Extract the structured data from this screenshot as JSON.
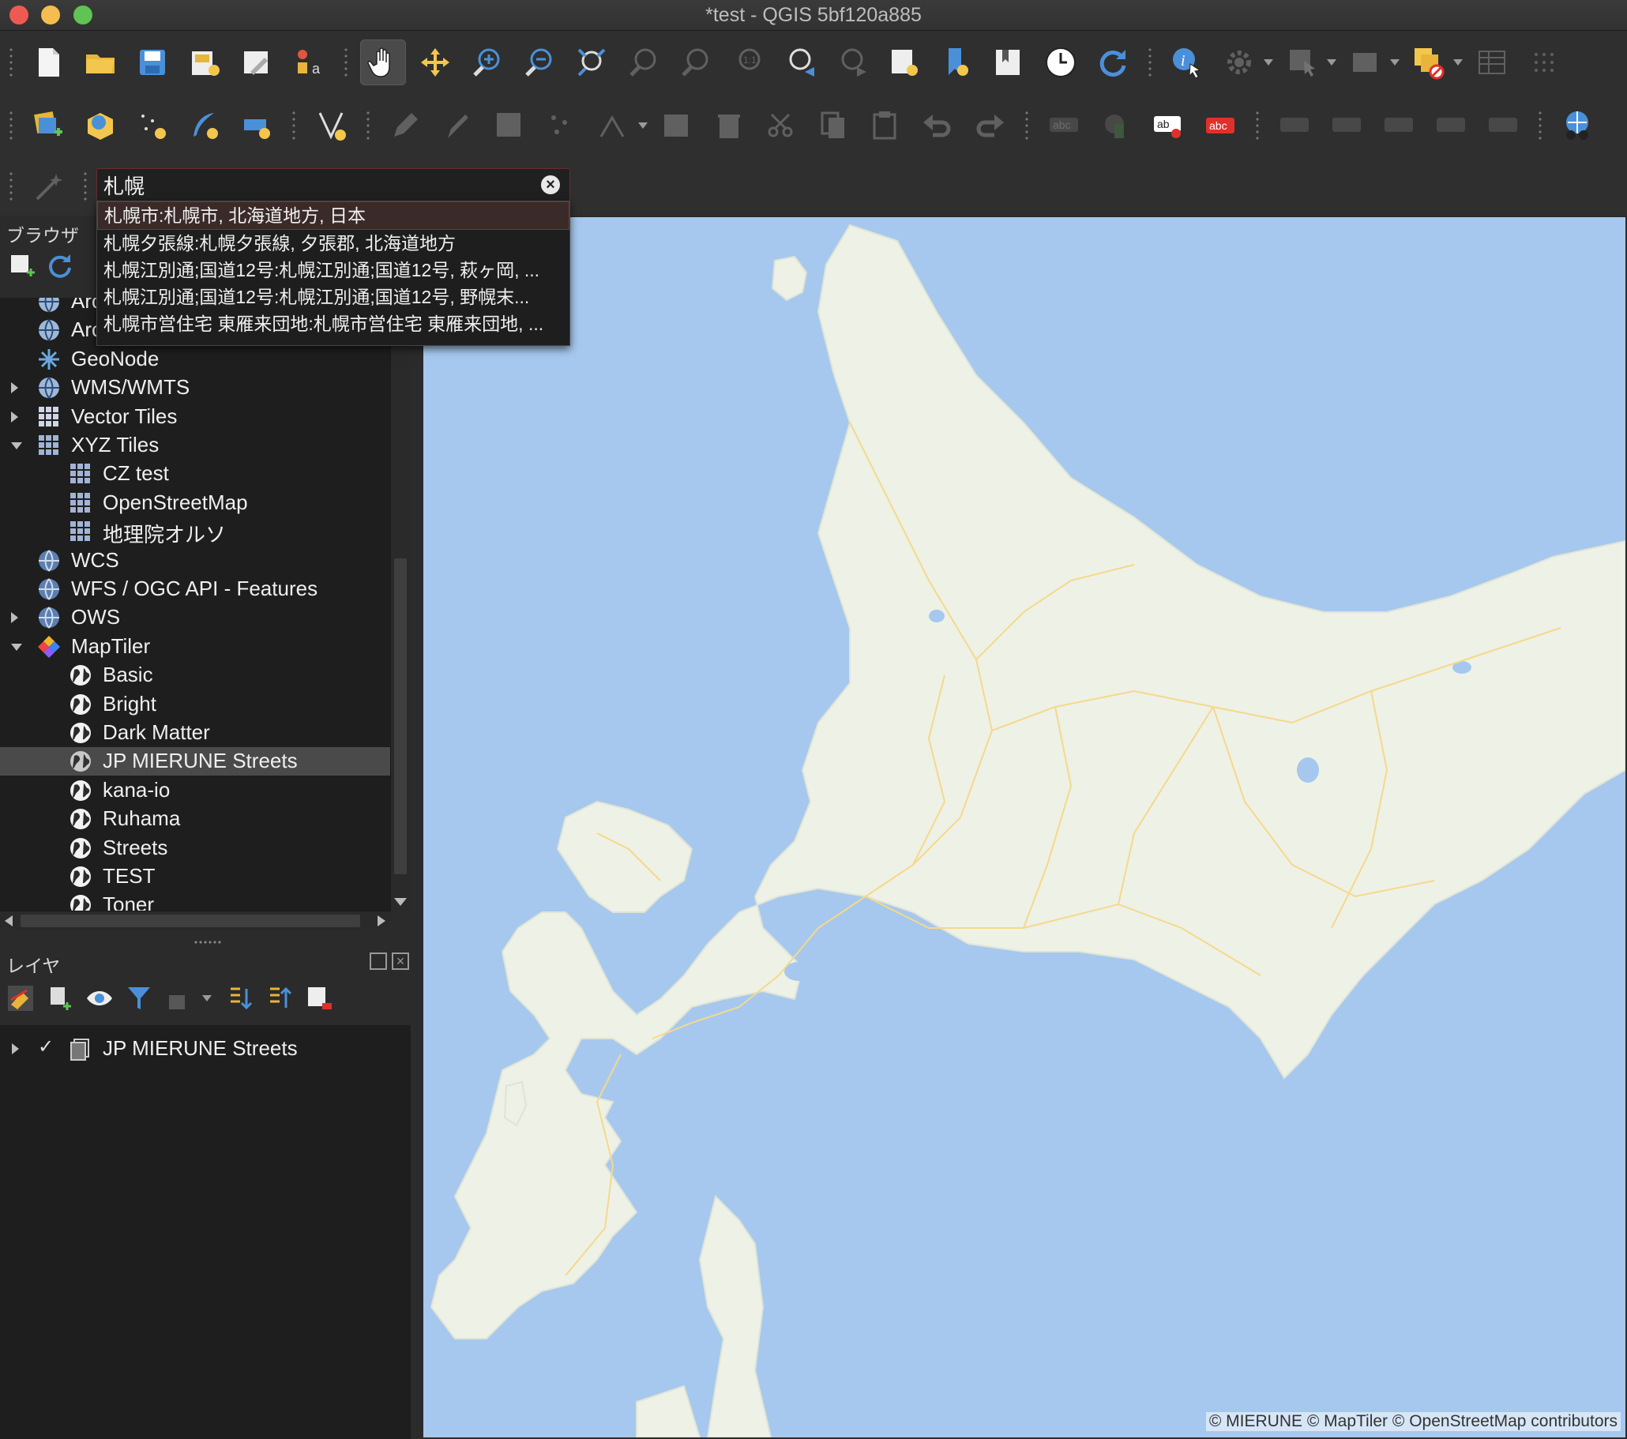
{
  "window": {
    "title": "*test - QGIS 5bf120a885"
  },
  "colors": {
    "accent": "#4a90d9",
    "sea": "#a6c8ee",
    "land": "#eef1e6",
    "road": "#f5d98a"
  },
  "search": {
    "value": "札幌",
    "suggestions": [
      "札幌市:札幌市, 北海道地方, 日本",
      "札幌夕張線:札幌夕張線, 夕張郡, 北海道地方",
      "札幌江別通;国道12号:札幌江別通;国道12号, 萩ヶ岡, ...",
      "札幌江別通;国道12号:札幌江別通;国道12号, 野幌末...",
      "札幌市営住宅 東雁来団地:札幌市営住宅 東雁来団地, ..."
    ]
  },
  "browser": {
    "title": "ブラウザ",
    "items": [
      {
        "label": "ArcGIS MapServer",
        "icon": "arcgis-globe-icon",
        "expander": "none"
      },
      {
        "label": "ArcGIS FeatureServer",
        "icon": "arcgis-globe-icon",
        "expander": "none"
      },
      {
        "label": "GeoNode",
        "icon": "geonode-icon",
        "expander": "none"
      },
      {
        "label": "WMS/WMTS",
        "icon": "wms-globe-icon",
        "expander": "right"
      },
      {
        "label": "Vector Tiles",
        "icon": "vector-tiles-icon",
        "expander": "right"
      },
      {
        "label": "XYZ Tiles",
        "icon": "xyz-tiles-icon",
        "expander": "down"
      },
      {
        "label": "CZ test",
        "icon": "tile-grid-icon",
        "expander": "none"
      },
      {
        "label": "OpenStreetMap",
        "icon": "tile-grid-icon",
        "expander": "none"
      },
      {
        "label": "地理院オルソ",
        "icon": "tile-grid-icon",
        "expander": "none"
      },
      {
        "label": "WCS",
        "icon": "wcs-globe-icon",
        "expander": "none"
      },
      {
        "label": "WFS / OGC API - Features",
        "icon": "wfs-globe-icon",
        "expander": "none"
      },
      {
        "label": "OWS",
        "icon": "ows-globe-icon",
        "expander": "right"
      },
      {
        "label": "MapTiler",
        "icon": "maptiler-logo-icon",
        "expander": "down"
      },
      {
        "label": "Basic",
        "icon": "earth-icon",
        "expander": "none"
      },
      {
        "label": "Bright",
        "icon": "earth-icon",
        "expander": "none"
      },
      {
        "label": "Dark Matter",
        "icon": "earth-icon",
        "expander": "none"
      },
      {
        "label": "JP MIERUNE Streets",
        "icon": "earth-icon",
        "expander": "none",
        "selected": true
      },
      {
        "label": "kana-io",
        "icon": "earth-icon",
        "expander": "none"
      },
      {
        "label": "Ruhama",
        "icon": "earth-icon",
        "expander": "none"
      },
      {
        "label": "Streets",
        "icon": "earth-icon",
        "expander": "none"
      },
      {
        "label": "TEST",
        "icon": "earth-icon",
        "expander": "none"
      },
      {
        "label": "Toner",
        "icon": "earth-icon",
        "expander": "none"
      }
    ]
  },
  "layers": {
    "title": "レイヤ",
    "items": [
      {
        "label": "JP MIERUNE Streets",
        "checked": "✓"
      }
    ]
  },
  "map": {
    "attribution": "© MIERUNE  © MapTiler  © OpenStreetMap contributors"
  }
}
